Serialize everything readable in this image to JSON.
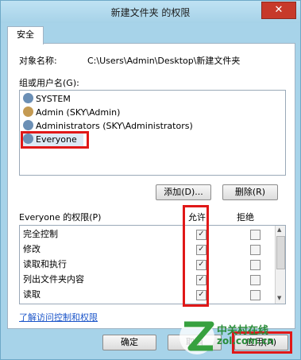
{
  "window": {
    "title": "新建文件夹 的权限",
    "close_glyph": "✕"
  },
  "tabs": {
    "security": "安全"
  },
  "object": {
    "label": "对象名称:",
    "value": "C:\\Users\\Admin\\Desktop\\新建文件夹"
  },
  "users": {
    "label": "组或用户名(G):",
    "items": [
      {
        "name": "SYSTEM",
        "icon": "group-icon"
      },
      {
        "name": "Admin (SKY\\Admin)",
        "icon": "user-icon"
      },
      {
        "name": "Administrators (SKY\\Administrators)",
        "icon": "group-icon"
      },
      {
        "name": "Everyone",
        "icon": "group-icon",
        "selected": true
      }
    ]
  },
  "buttons": {
    "add": "添加(D)...",
    "remove": "删除(R)",
    "ok": "确定",
    "cancel": "取消",
    "apply": "应用(A)"
  },
  "permissions": {
    "label": "Everyone 的权限(P)",
    "allow_header": "允许",
    "deny_header": "拒绝",
    "rows": [
      {
        "name": "完全控制",
        "allow": true,
        "deny": false
      },
      {
        "name": "修改",
        "allow": true,
        "deny": false
      },
      {
        "name": "读取和执行",
        "allow": true,
        "deny": false
      },
      {
        "name": "列出文件夹内容",
        "allow": true,
        "deny": false
      },
      {
        "name": "读取",
        "allow": true,
        "deny": false
      }
    ]
  },
  "learn_link": "了解访问控制和权限",
  "watermark": {
    "text": "中关村在线",
    "sub": "zol.com.cn"
  },
  "colors": {
    "highlight": "#e01818",
    "titlebar": "#a6d2e8",
    "close": "#c7392a"
  }
}
